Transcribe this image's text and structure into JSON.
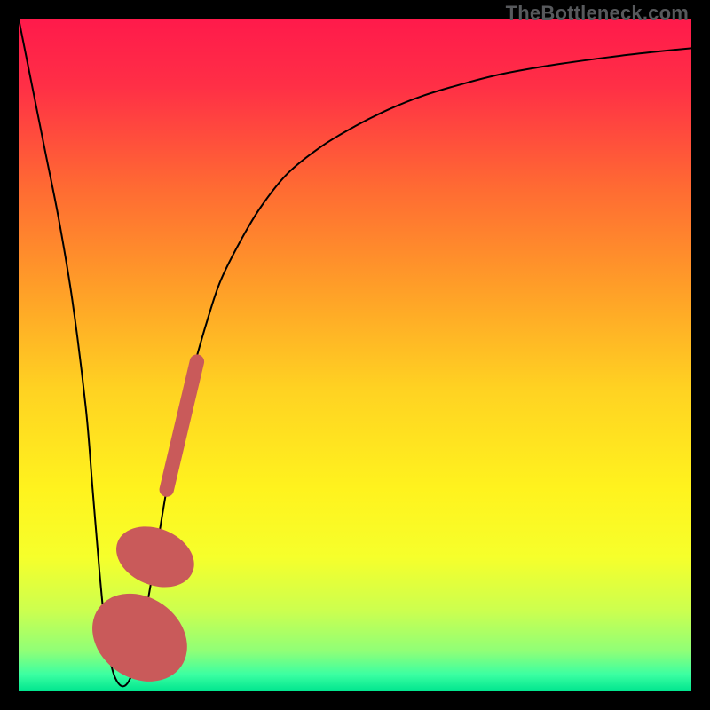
{
  "watermark": "TheBottleneck.com",
  "colors": {
    "stops": [
      {
        "offset": 0.0,
        "color": "#ff1a4b"
      },
      {
        "offset": 0.1,
        "color": "#ff2f46"
      },
      {
        "offset": 0.25,
        "color": "#ff6a33"
      },
      {
        "offset": 0.4,
        "color": "#ff9e28"
      },
      {
        "offset": 0.55,
        "color": "#ffd222"
      },
      {
        "offset": 0.7,
        "color": "#fff31e"
      },
      {
        "offset": 0.8,
        "color": "#f6ff2b"
      },
      {
        "offset": 0.88,
        "color": "#ccff4f"
      },
      {
        "offset": 0.94,
        "color": "#90ff77"
      },
      {
        "offset": 0.975,
        "color": "#3bffa2"
      },
      {
        "offset": 1.0,
        "color": "#00e58f"
      }
    ],
    "marker": "#c95a5a",
    "curve": "#000000"
  },
  "chart_data": {
    "type": "line",
    "title": "",
    "xlabel": "",
    "ylabel": "",
    "xlim": [
      0,
      100
    ],
    "ylim": [
      0,
      100
    ],
    "series": [
      {
        "name": "bottleneck-curve",
        "x": [
          0,
          2,
          4,
          6,
          8,
          10,
          11,
          12,
          13,
          14,
          15,
          16,
          17,
          18,
          20,
          22,
          24,
          26,
          28,
          30,
          33,
          36,
          40,
          45,
          50,
          55,
          60,
          66,
          72,
          80,
          88,
          94,
          100
        ],
        "y": [
          100,
          90,
          80,
          70,
          58,
          42,
          30,
          18,
          8,
          3,
          1,
          1,
          3,
          7,
          18,
          30,
          40,
          48,
          55,
          61,
          67,
          72,
          77,
          81,
          84,
          86.5,
          88.5,
          90.3,
          91.8,
          93.2,
          94.3,
          95.0,
          95.6
        ]
      }
    ],
    "markers": [
      {
        "name": "highlight-segment",
        "x0": 22.0,
        "y0": 30.0,
        "x1": 26.5,
        "y1": 49.0,
        "width": 12
      },
      {
        "name": "highlight-dot-upper",
        "shape": "ellipse",
        "cx": 20.3,
        "cy": 20.0,
        "rx": 4.2,
        "ry": 6.0,
        "rotate": -68
      },
      {
        "name": "highlight-dot-lower",
        "shape": "ellipse",
        "cx": 18.0,
        "cy": 8.0,
        "rx": 6.0,
        "ry": 7.5,
        "rotate": -55
      }
    ]
  }
}
